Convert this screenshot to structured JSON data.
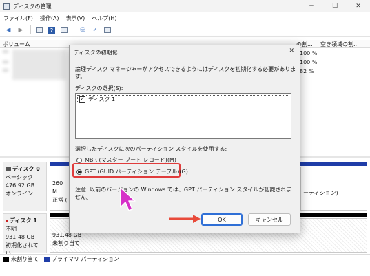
{
  "window": {
    "title": "ディスクの管理",
    "controls": {
      "minimize": "─",
      "maximize": "☐",
      "close": "✕"
    }
  },
  "menu": [
    "ファイル(F)",
    "操作(A)",
    "表示(V)",
    "ヘルプ(H)"
  ],
  "volume_list": {
    "columns": [
      "ボリューム",
      "の割...",
      "空き領域の割..."
    ],
    "percents": [
      "100 %",
      "100 %",
      "82 %"
    ]
  },
  "disks": [
    {
      "name": "ディスク 0",
      "type": "ベーシック",
      "size": "476.92 GB",
      "status": "オンライン",
      "partition_text_1": "260 M",
      "partition_text_2": "正常 (",
      "partition_right_text": "ーティション)"
    },
    {
      "name": "ディスク 1",
      "type": "不明",
      "size": "931.48 GB",
      "status": "初期化されてい...",
      "partition_size": "931.48 GB",
      "partition_status": "未割り当て"
    }
  ],
  "legend": [
    {
      "label": "未割り当て",
      "color": "#000000"
    },
    {
      "label": "プライマリ パーティション",
      "color": "#1f3da8"
    }
  ],
  "dialog": {
    "title": "ディスクの初期化",
    "close": "✕",
    "intro": "論理ディスク マネージャーがアクセスできるようにはディスクを初期化する必要があります。",
    "select_label": "ディスクの選択(S):",
    "disk_item": "ディスク 1",
    "style_label": "選択したディスクに次のパーティション スタイルを使用する:",
    "mbr_option": "MBR (マスター ブート レコード)(M)",
    "gpt_option": "GPT (GUID パーティション テーブル)(G)",
    "note": "注意: 以前のバージョンの Windows では、GPT パーティション スタイルが認識されません。",
    "ok": "OK",
    "cancel": "キャンセル"
  },
  "colors": {
    "highlight": "#e03c3c",
    "arrow": "#e84a3a",
    "cursor": "#d62fc8",
    "primary_partition": "#1f3da8",
    "default_button_border": "#2f6fd6"
  }
}
